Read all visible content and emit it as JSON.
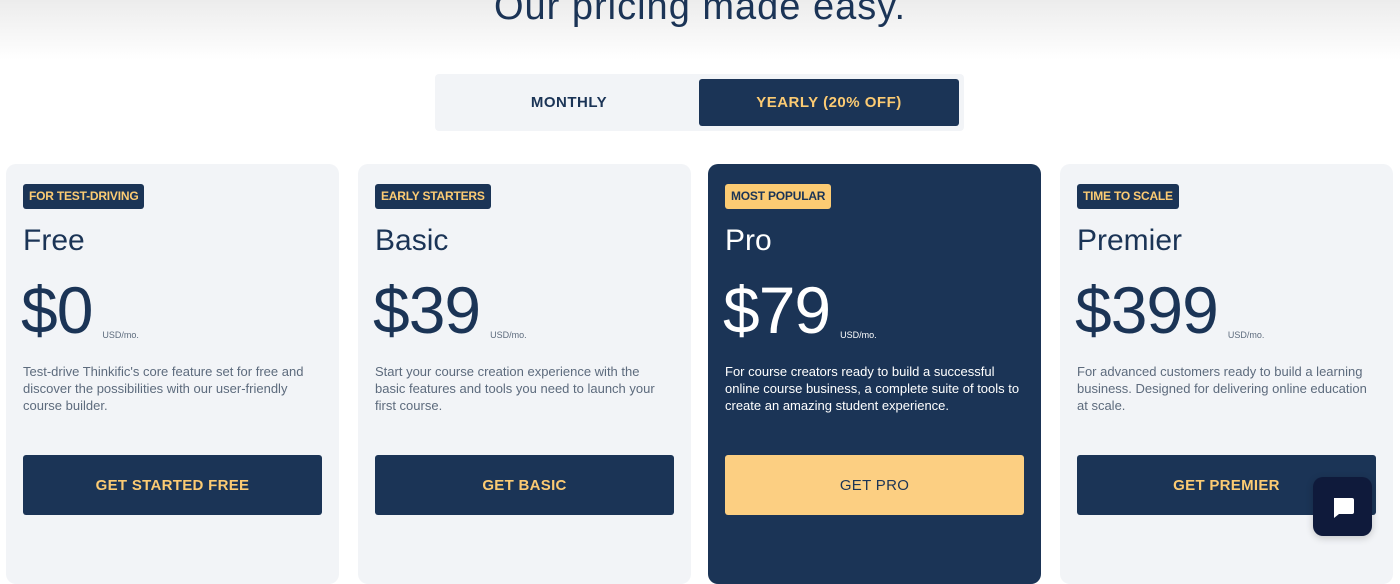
{
  "header": {
    "title": "Our pricing made easy."
  },
  "billing_toggle": {
    "monthly_label": "MONTHLY",
    "yearly_label": "YEARLY (20% OFF)",
    "selected": "yearly"
  },
  "plans": [
    {
      "badge": "FOR TEST-DRIVING",
      "name": "Free",
      "price": "$0",
      "unit": "USD/mo.",
      "description": "Test-drive Thinkific's core feature set for free and discover the possibilities with our user-friendly course builder.",
      "cta": "GET STARTED FREE"
    },
    {
      "badge": "EARLY STARTERS",
      "name": "Basic",
      "price": "$39",
      "unit": "USD/mo.",
      "description": "Start your course creation experience with the basic features and tools you need to launch your first course.",
      "cta": "GET BASIC"
    },
    {
      "badge": "MOST POPULAR",
      "name": "Pro",
      "price": "$79",
      "unit": "USD/mo.",
      "description": "For course creators ready to build a successful online course business, a complete suite of tools to create an amazing student experience.",
      "cta": "GET PRO"
    },
    {
      "badge": "TIME TO SCALE",
      "name": "Premier",
      "price": "$399",
      "unit": "USD/mo.",
      "description": "For advanced customers ready to build a learning business. Designed for delivering online education at scale.",
      "cta": "GET PREMIER"
    }
  ],
  "chat_widget": {
    "icon": "chat-bubble-icon"
  },
  "colors": {
    "navy": "#1b3456",
    "gold": "#fccb73",
    "card_bg": "#f2f4f7",
    "muted_text": "#5d6b7d"
  }
}
